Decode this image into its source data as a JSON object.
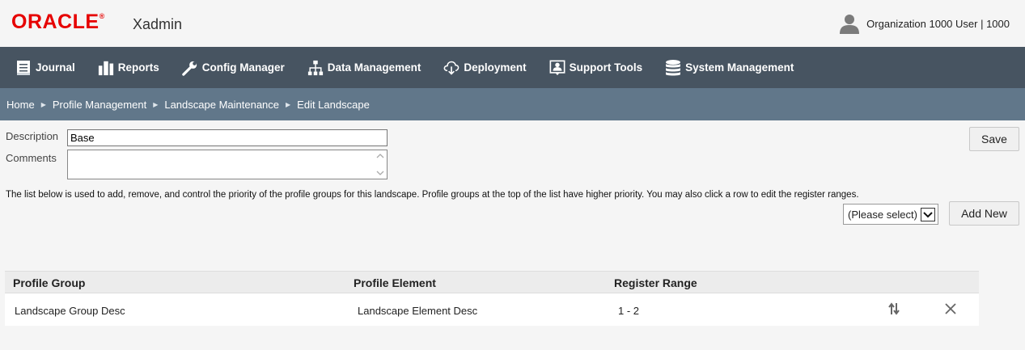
{
  "header": {
    "logo_text": "ORACLE",
    "logo_reg": "®",
    "app_name": "Xadmin",
    "user_label": "Organization 1000 User | 1000",
    "user_icon": "user-icon",
    "brand_color": "#e60000"
  },
  "nav": {
    "items": [
      {
        "label": "Journal",
        "icon": "journal-icon"
      },
      {
        "label": "Reports",
        "icon": "reports-icon"
      },
      {
        "label": "Config Manager",
        "icon": "wrench-icon"
      },
      {
        "label": "Data Management",
        "icon": "hierarchy-icon"
      },
      {
        "label": "Deployment",
        "icon": "cloud-download-icon"
      },
      {
        "label": "Support Tools",
        "icon": "support-icon"
      },
      {
        "label": "System Management",
        "icon": "database-icon"
      }
    ],
    "bg_color": "#475461"
  },
  "breadcrumb": {
    "items": [
      "Home",
      "Profile Management",
      "Landscape Maintenance",
      "Edit Landscape"
    ],
    "separator": "▶",
    "bg_color": "#61778a"
  },
  "form": {
    "description_label": "Description",
    "description_value": "Base",
    "comments_label": "Comments",
    "comments_value": "",
    "save_label": "Save",
    "info_text": "The list below is used to add, remove, and control the priority of the profile groups for this landscape. Profile groups at the top of the list have higher priority. You may also click a row to edit the register ranges.",
    "select_value": "(Please select)",
    "add_new_label": "Add New"
  },
  "table": {
    "headers": [
      "Profile Group",
      "Profile Element",
      "Register Range"
    ],
    "rows": [
      {
        "group": "Landscape Group Desc",
        "element": "Landscape Element Desc",
        "range": "1 - 2",
        "reorder_icon": "reorder-icon",
        "delete_icon": "close-icon"
      }
    ]
  }
}
